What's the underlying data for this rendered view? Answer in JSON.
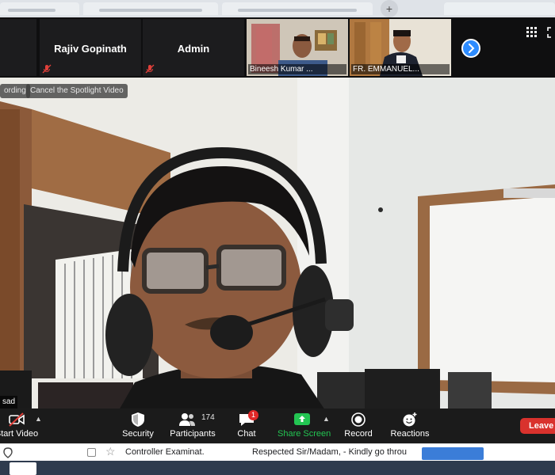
{
  "participant_strip": {
    "tiles": [
      {
        "name": "Rajiv Gopinath",
        "muted": true
      },
      {
        "name": "Admin",
        "muted": true
      }
    ],
    "video_tiles": [
      {
        "name": "Bineesh Kumar ..."
      },
      {
        "name": "FR. EMMANUEL..."
      }
    ],
    "next_icon": "chevron-right-icon",
    "grid_icon": "grid-view-icon",
    "fullscreen_icon": "fullscreen-icon"
  },
  "main_video": {
    "recording_label": "ording",
    "spotlight_label": "Cancel the Spotlight Video",
    "speaker_name": "sad"
  },
  "toolbar": {
    "start_video": "Start Video",
    "security": "Security",
    "participants": "Participants",
    "participants_count": "174",
    "chat": "Chat",
    "chat_badge": "1",
    "share_screen": "Share Screen",
    "record": "Record",
    "reactions": "Reactions",
    "leave": "Leave"
  },
  "mail_row": {
    "sender": "Controller Examinat.",
    "snippet": "Respected Sir/Madam, - Kindly go throu"
  },
  "colors": {
    "accent_blue": "#2d8cff",
    "share_green": "#23c552",
    "leave_red": "#d9322d",
    "badge_red": "#e02828"
  }
}
